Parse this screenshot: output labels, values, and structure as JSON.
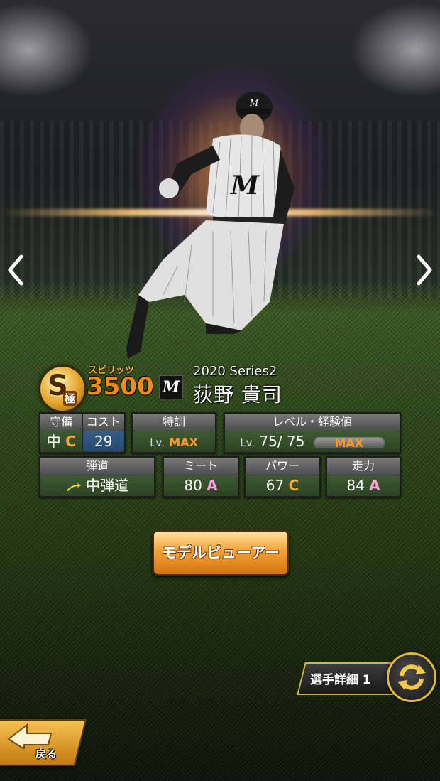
{
  "card": {
    "rank_letter": "S",
    "rank_sub": "極",
    "spirits_label": "スピリッツ",
    "spirits_value": "3500",
    "team_logo": "M",
    "series": "2020 Series2",
    "player_name": "荻野 貴司"
  },
  "stats": {
    "position": {
      "label": "守備",
      "value": "中",
      "grade": "C"
    },
    "cost": {
      "label": "コスト",
      "value": "29"
    },
    "training": {
      "label": "特訓",
      "lv": "Lv.",
      "value": "MAX"
    },
    "level": {
      "label": "レベル・経験値",
      "lv": "Lv.",
      "current": "75/",
      "max": "75",
      "bar_text": "MAX",
      "bar_fill_pct": 100
    },
    "trajectory": {
      "label": "弾道",
      "value": "中弾道"
    },
    "meet": {
      "label": "ミート",
      "value": "80",
      "grade": "A"
    },
    "power": {
      "label": "パワー",
      "value": "67",
      "grade": "C"
    },
    "speed": {
      "label": "走力",
      "value": "84",
      "grade": "A"
    }
  },
  "buttons": {
    "model_viewer": "モデルビューアー",
    "player_detail": "選手詳細 1",
    "back": "戻る"
  },
  "icons": {
    "prev": "chevron-left-icon",
    "next": "chevron-right-icon",
    "switch": "refresh-arrows-icon",
    "back": "back-arrow-icon"
  },
  "colors": {
    "accent_orange": "#f08a1a",
    "grade_a": "#ff9ee0",
    "grade_c": "#ffa53a",
    "gold": "#e2b733"
  }
}
